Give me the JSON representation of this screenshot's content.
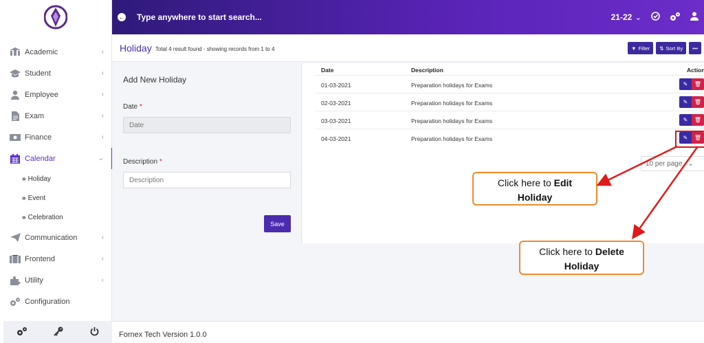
{
  "header": {
    "search_text": "Type anywhere to start search...",
    "session": "21-22"
  },
  "sidebar": {
    "items": [
      {
        "label": "Academic",
        "icon": "academic-icon"
      },
      {
        "label": "Student",
        "icon": "graduation-cap-icon"
      },
      {
        "label": "Employee",
        "icon": "user-tie-icon"
      },
      {
        "label": "Exam",
        "icon": "file-icon"
      },
      {
        "label": "Finance",
        "icon": "money-bill-icon"
      },
      {
        "label": "Calendar",
        "icon": "calendar-icon"
      },
      {
        "label": "Communication",
        "icon": "paper-plane-icon"
      },
      {
        "label": "Frontend",
        "icon": "frontend-icon"
      },
      {
        "label": "Utility",
        "icon": "puzzle-icon"
      },
      {
        "label": "Configuration",
        "icon": "cogs-icon"
      }
    ],
    "calendar_sub": [
      "Holiday",
      "Event",
      "Celebration"
    ],
    "active": "Calendar"
  },
  "page": {
    "title": "Holiday",
    "subtitle": "Total 4 result found - showing records from 1 to 4",
    "filter_label": "Filter",
    "sort_label": "Sort By",
    "more_label": "•••"
  },
  "form": {
    "title": "Add New Holiday",
    "date_label": "Date",
    "date_placeholder": "Date",
    "desc_label": "Description",
    "desc_placeholder": "Description",
    "save_label": "Save"
  },
  "table": {
    "headers": [
      "Date",
      "Description",
      "Action"
    ],
    "rows": [
      {
        "date": "01-03-2021",
        "description": "Preparation holidays for Exams"
      },
      {
        "date": "02-03-2021",
        "description": "Preparation holidays for Exams"
      },
      {
        "date": "03-03-2021",
        "description": "Preparation holidays for Exams"
      },
      {
        "date": "04-03-2021",
        "description": "Preparation holidays for Exams"
      }
    ],
    "per_page": "10 per page"
  },
  "footer": {
    "text": "Fornex Tech Version 1.0.0"
  },
  "callouts": {
    "edit_pre": "Click here to",
    "edit_bold_1": "Edit",
    "edit_bold_2": "Holiday",
    "delete_pre": "Click here to",
    "delete_bold_1": "Delete",
    "delete_bold_2": "Holiday"
  },
  "colors": {
    "brand": "#5b2fc9",
    "header_dark": "#2f1a7a",
    "delete": "#d2224a",
    "callout_border": "#f08a2d",
    "highlight": "#d8151a"
  }
}
